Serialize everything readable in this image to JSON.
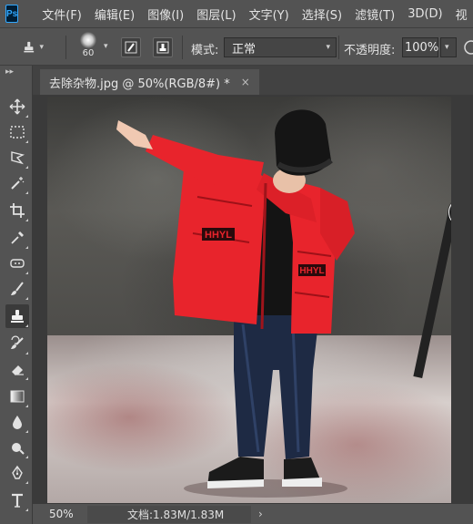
{
  "app": {
    "logo_text": "Ps"
  },
  "menu": {
    "items": [
      "文件(F)",
      "编辑(E)",
      "图像(I)",
      "图层(L)",
      "文字(Y)",
      "选择(S)",
      "滤镜(T)",
      "3D(D)",
      "视"
    ]
  },
  "options": {
    "brush_size": "60",
    "mode_label": "模式:",
    "mode_value": "正常",
    "opacity_label": "不透明度:",
    "opacity_value": "100%"
  },
  "document": {
    "tab_title": "去除杂物.jpg @ 50%(RGB/8#) *",
    "tab_close": "×"
  },
  "status": {
    "zoom": "50%",
    "doc_info": "文档:1.83M/1.83M",
    "arrow": "›"
  },
  "tools": [
    "move-icon",
    "marquee-icon",
    "lasso-icon",
    "quick-select-icon",
    "crop-icon",
    "eyedropper-icon",
    "healing-icon",
    "brush-icon",
    "clone-stamp-icon",
    "history-brush-icon",
    "eraser-icon",
    "gradient-icon",
    "blur-icon",
    "dodge-icon",
    "pen-icon",
    "type-icon"
  ],
  "active_tool": "clone-stamp-icon",
  "photo": {
    "subject_text": "HHYL",
    "colors": {
      "jacket": "#e8242c",
      "hat": "#151515",
      "jeans": "#1e2a44",
      "wall": "#4f4e4b",
      "floor": "#cfc4c1"
    }
  }
}
